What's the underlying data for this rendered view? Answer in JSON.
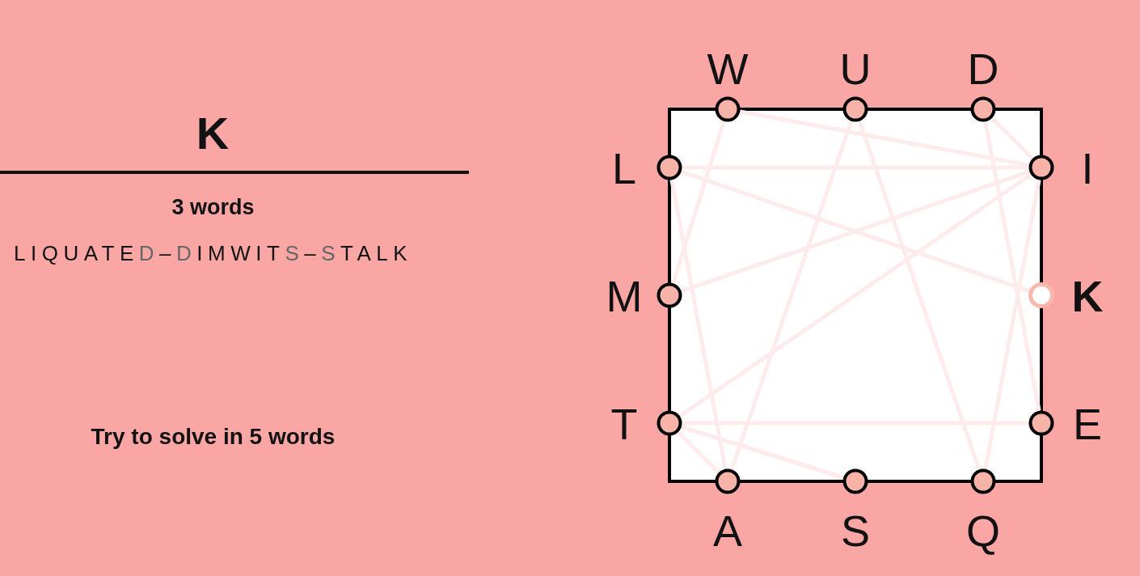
{
  "current_word": "K",
  "word_count": "3 words",
  "found_words": {
    "words": [
      "LIQUATED",
      "DIMWITS",
      "STALK"
    ],
    "separator": "–"
  },
  "goal": "Try to solve in 5 words",
  "board": {
    "sides": [
      {
        "kind": "top",
        "letters": [
          {
            "letter": "W",
            "selected": false
          },
          {
            "letter": "U",
            "selected": false
          },
          {
            "letter": "D",
            "selected": false
          }
        ]
      },
      {
        "kind": "right",
        "letters": [
          {
            "letter": "I",
            "selected": false
          },
          {
            "letter": "K",
            "selected": true
          },
          {
            "letter": "E",
            "selected": false
          }
        ]
      },
      {
        "kind": "bottom",
        "letters": [
          {
            "letter": "A",
            "selected": false
          },
          {
            "letter": "S",
            "selected": false
          },
          {
            "letter": "Q",
            "selected": false
          }
        ]
      },
      {
        "kind": "left",
        "letters": [
          {
            "letter": "L",
            "selected": false
          },
          {
            "letter": "M",
            "selected": false
          },
          {
            "letter": "T",
            "selected": false
          }
        ]
      }
    ]
  }
}
